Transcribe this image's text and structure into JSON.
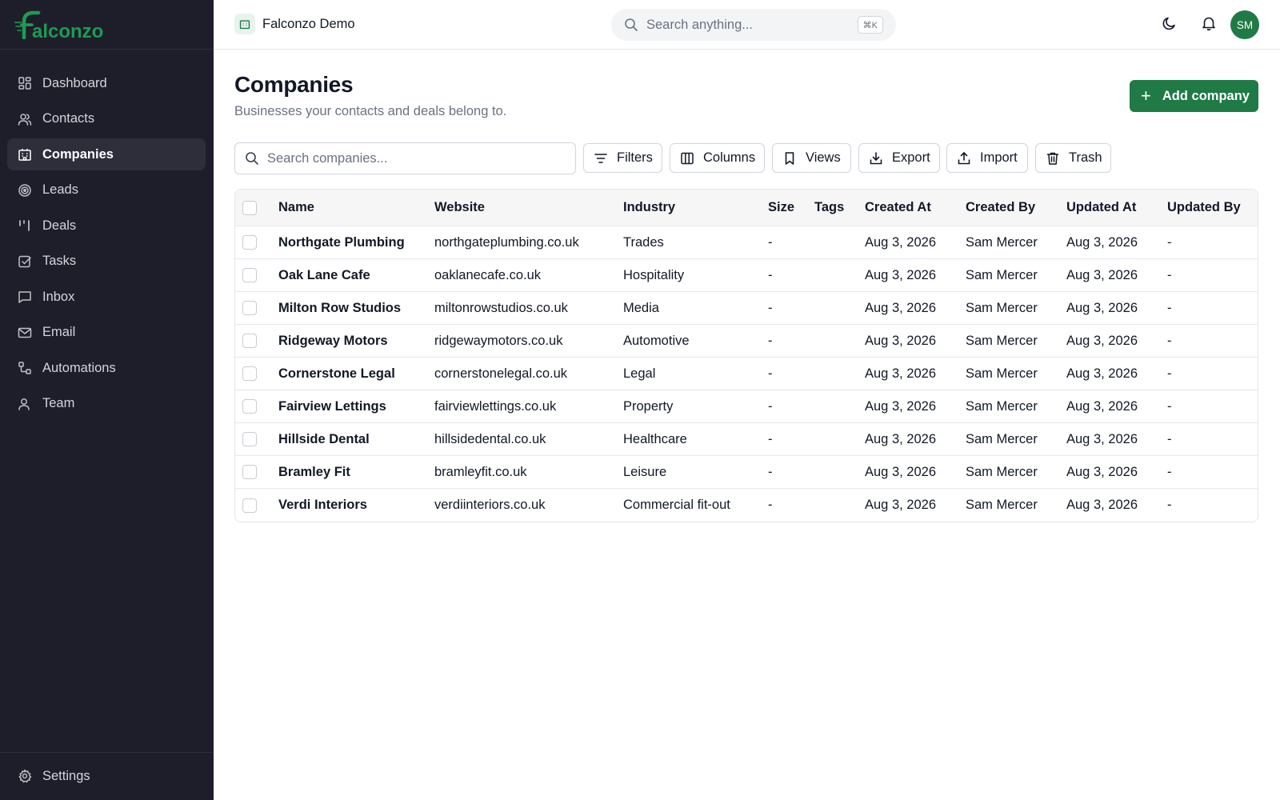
{
  "app": {
    "brand_logo_text": "Falconzo",
    "workspace_name": "Falconzo Demo"
  },
  "sidebar": {
    "items": [
      {
        "label": "Dashboard",
        "icon": "dashboard-icon",
        "active": false
      },
      {
        "label": "Contacts",
        "icon": "users-icon",
        "active": false
      },
      {
        "label": "Companies",
        "icon": "building-icon",
        "active": true
      },
      {
        "label": "Leads",
        "icon": "target-icon",
        "active": false
      },
      {
        "label": "Deals",
        "icon": "kanban-icon",
        "active": false
      },
      {
        "label": "Tasks",
        "icon": "checkbox-icon",
        "active": false
      },
      {
        "label": "Inbox",
        "icon": "message-icon",
        "active": false
      },
      {
        "label": "Email",
        "icon": "mail-icon",
        "active": false
      },
      {
        "label": "Automations",
        "icon": "workflow-icon",
        "active": false
      },
      {
        "label": "Team",
        "icon": "user-icon",
        "active": false
      }
    ],
    "settings_label": "Settings"
  },
  "topbar": {
    "search_placeholder": "Search anything...",
    "shortcut": "⌘K",
    "avatar_initials": "SM"
  },
  "page": {
    "title": "Companies",
    "subtitle": "Businesses your contacts and deals belong to.",
    "add_button": "Add company"
  },
  "toolbar": {
    "search_placeholder": "Search companies...",
    "filters": "Filters",
    "columns": "Columns",
    "views": "Views",
    "export": "Export",
    "import": "Import",
    "trash": "Trash"
  },
  "table": {
    "headers": {
      "name": "Name",
      "website": "Website",
      "industry": "Industry",
      "size": "Size",
      "tags": "Tags",
      "created_at": "Created At",
      "created_by": "Created By",
      "updated_at": "Updated At",
      "updated_by": "Updated By"
    },
    "rows": [
      {
        "name": "Northgate Plumbing",
        "website": "northgateplumbing.co.uk",
        "industry": "Trades",
        "size": "-",
        "tags": "",
        "created_at": "Aug 3, 2026",
        "created_by": "Sam Mercer",
        "updated_at": "Aug 3, 2026",
        "updated_by": "-"
      },
      {
        "name": "Oak Lane Cafe",
        "website": "oaklanecafe.co.uk",
        "industry": "Hospitality",
        "size": "-",
        "tags": "",
        "created_at": "Aug 3, 2026",
        "created_by": "Sam Mercer",
        "updated_at": "Aug 3, 2026",
        "updated_by": "-"
      },
      {
        "name": "Milton Row Studios",
        "website": "miltonrowstudios.co.uk",
        "industry": "Media",
        "size": "-",
        "tags": "",
        "created_at": "Aug 3, 2026",
        "created_by": "Sam Mercer",
        "updated_at": "Aug 3, 2026",
        "updated_by": "-"
      },
      {
        "name": "Ridgeway Motors",
        "website": "ridgewaymotors.co.uk",
        "industry": "Automotive",
        "size": "-",
        "tags": "",
        "created_at": "Aug 3, 2026",
        "created_by": "Sam Mercer",
        "updated_at": "Aug 3, 2026",
        "updated_by": "-"
      },
      {
        "name": "Cornerstone Legal",
        "website": "cornerstonelegal.co.uk",
        "industry": "Legal",
        "size": "-",
        "tags": "",
        "created_at": "Aug 3, 2026",
        "created_by": "Sam Mercer",
        "updated_at": "Aug 3, 2026",
        "updated_by": "-"
      },
      {
        "name": "Fairview Lettings",
        "website": "fairviewlettings.co.uk",
        "industry": "Property",
        "size": "-",
        "tags": "",
        "created_at": "Aug 3, 2026",
        "created_by": "Sam Mercer",
        "updated_at": "Aug 3, 2026",
        "updated_by": "-"
      },
      {
        "name": "Hillside Dental",
        "website": "hillsidedental.co.uk",
        "industry": "Healthcare",
        "size": "-",
        "tags": "",
        "created_at": "Aug 3, 2026",
        "created_by": "Sam Mercer",
        "updated_at": "Aug 3, 2026",
        "updated_by": "-"
      },
      {
        "name": "Bramley Fit",
        "website": "bramleyfit.co.uk",
        "industry": "Leisure",
        "size": "-",
        "tags": "",
        "created_at": "Aug 3, 2026",
        "created_by": "Sam Mercer",
        "updated_at": "Aug 3, 2026",
        "updated_by": "-"
      },
      {
        "name": "Verdi Interiors",
        "website": "verdiinteriors.co.uk",
        "industry": "Commercial fit-out",
        "size": "-",
        "tags": "",
        "created_at": "Aug 3, 2026",
        "created_by": "Sam Mercer",
        "updated_at": "Aug 3, 2026",
        "updated_by": "-"
      }
    ]
  },
  "colors": {
    "sidebar_bg": "#1e1e2a",
    "accent_green": "#1f7a45"
  }
}
